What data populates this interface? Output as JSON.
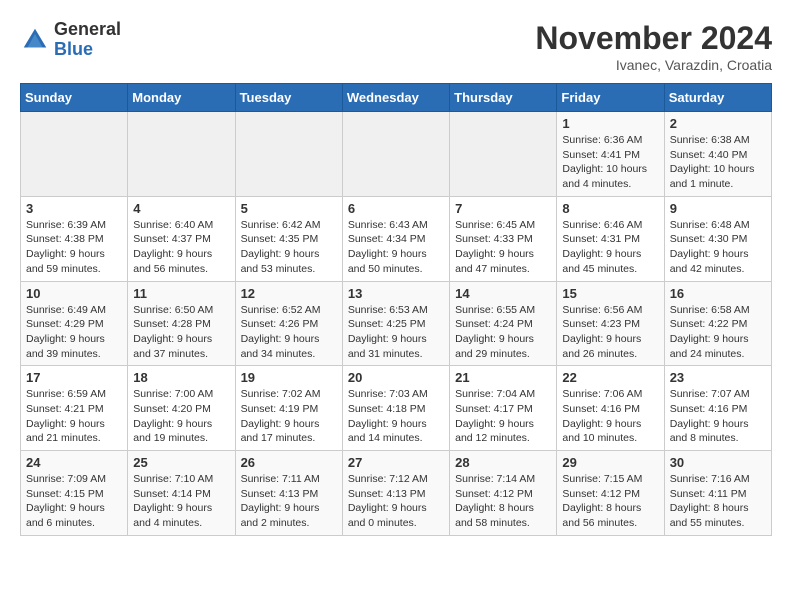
{
  "header": {
    "logo_general": "General",
    "logo_blue": "Blue",
    "month_title": "November 2024",
    "location": "Ivanec, Varazdin, Croatia"
  },
  "weekdays": [
    "Sunday",
    "Monday",
    "Tuesday",
    "Wednesday",
    "Thursday",
    "Friday",
    "Saturday"
  ],
  "weeks": [
    [
      {
        "day": "",
        "info": ""
      },
      {
        "day": "",
        "info": ""
      },
      {
        "day": "",
        "info": ""
      },
      {
        "day": "",
        "info": ""
      },
      {
        "day": "",
        "info": ""
      },
      {
        "day": "1",
        "info": "Sunrise: 6:36 AM\nSunset: 4:41 PM\nDaylight: 10 hours and 4 minutes."
      },
      {
        "day": "2",
        "info": "Sunrise: 6:38 AM\nSunset: 4:40 PM\nDaylight: 10 hours and 1 minute."
      }
    ],
    [
      {
        "day": "3",
        "info": "Sunrise: 6:39 AM\nSunset: 4:38 PM\nDaylight: 9 hours and 59 minutes."
      },
      {
        "day": "4",
        "info": "Sunrise: 6:40 AM\nSunset: 4:37 PM\nDaylight: 9 hours and 56 minutes."
      },
      {
        "day": "5",
        "info": "Sunrise: 6:42 AM\nSunset: 4:35 PM\nDaylight: 9 hours and 53 minutes."
      },
      {
        "day": "6",
        "info": "Sunrise: 6:43 AM\nSunset: 4:34 PM\nDaylight: 9 hours and 50 minutes."
      },
      {
        "day": "7",
        "info": "Sunrise: 6:45 AM\nSunset: 4:33 PM\nDaylight: 9 hours and 47 minutes."
      },
      {
        "day": "8",
        "info": "Sunrise: 6:46 AM\nSunset: 4:31 PM\nDaylight: 9 hours and 45 minutes."
      },
      {
        "day": "9",
        "info": "Sunrise: 6:48 AM\nSunset: 4:30 PM\nDaylight: 9 hours and 42 minutes."
      }
    ],
    [
      {
        "day": "10",
        "info": "Sunrise: 6:49 AM\nSunset: 4:29 PM\nDaylight: 9 hours and 39 minutes."
      },
      {
        "day": "11",
        "info": "Sunrise: 6:50 AM\nSunset: 4:28 PM\nDaylight: 9 hours and 37 minutes."
      },
      {
        "day": "12",
        "info": "Sunrise: 6:52 AM\nSunset: 4:26 PM\nDaylight: 9 hours and 34 minutes."
      },
      {
        "day": "13",
        "info": "Sunrise: 6:53 AM\nSunset: 4:25 PM\nDaylight: 9 hours and 31 minutes."
      },
      {
        "day": "14",
        "info": "Sunrise: 6:55 AM\nSunset: 4:24 PM\nDaylight: 9 hours and 29 minutes."
      },
      {
        "day": "15",
        "info": "Sunrise: 6:56 AM\nSunset: 4:23 PM\nDaylight: 9 hours and 26 minutes."
      },
      {
        "day": "16",
        "info": "Sunrise: 6:58 AM\nSunset: 4:22 PM\nDaylight: 9 hours and 24 minutes."
      }
    ],
    [
      {
        "day": "17",
        "info": "Sunrise: 6:59 AM\nSunset: 4:21 PM\nDaylight: 9 hours and 21 minutes."
      },
      {
        "day": "18",
        "info": "Sunrise: 7:00 AM\nSunset: 4:20 PM\nDaylight: 9 hours and 19 minutes."
      },
      {
        "day": "19",
        "info": "Sunrise: 7:02 AM\nSunset: 4:19 PM\nDaylight: 9 hours and 17 minutes."
      },
      {
        "day": "20",
        "info": "Sunrise: 7:03 AM\nSunset: 4:18 PM\nDaylight: 9 hours and 14 minutes."
      },
      {
        "day": "21",
        "info": "Sunrise: 7:04 AM\nSunset: 4:17 PM\nDaylight: 9 hours and 12 minutes."
      },
      {
        "day": "22",
        "info": "Sunrise: 7:06 AM\nSunset: 4:16 PM\nDaylight: 9 hours and 10 minutes."
      },
      {
        "day": "23",
        "info": "Sunrise: 7:07 AM\nSunset: 4:16 PM\nDaylight: 9 hours and 8 minutes."
      }
    ],
    [
      {
        "day": "24",
        "info": "Sunrise: 7:09 AM\nSunset: 4:15 PM\nDaylight: 9 hours and 6 minutes."
      },
      {
        "day": "25",
        "info": "Sunrise: 7:10 AM\nSunset: 4:14 PM\nDaylight: 9 hours and 4 minutes."
      },
      {
        "day": "26",
        "info": "Sunrise: 7:11 AM\nSunset: 4:13 PM\nDaylight: 9 hours and 2 minutes."
      },
      {
        "day": "27",
        "info": "Sunrise: 7:12 AM\nSunset: 4:13 PM\nDaylight: 9 hours and 0 minutes."
      },
      {
        "day": "28",
        "info": "Sunrise: 7:14 AM\nSunset: 4:12 PM\nDaylight: 8 hours and 58 minutes."
      },
      {
        "day": "29",
        "info": "Sunrise: 7:15 AM\nSunset: 4:12 PM\nDaylight: 8 hours and 56 minutes."
      },
      {
        "day": "30",
        "info": "Sunrise: 7:16 AM\nSunset: 4:11 PM\nDaylight: 8 hours and 55 minutes."
      }
    ]
  ]
}
